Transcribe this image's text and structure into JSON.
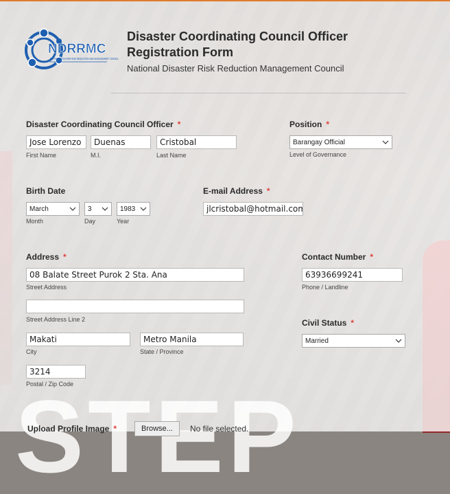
{
  "header": {
    "logo_text": "NDRRMC",
    "logo_subtext": "NATIONAL DISASTER RISK REDUCTION AND MANAGEMENT COUNCIL",
    "title": "Disaster Coordinating Council Officer Registration Form",
    "subtitle": "National Disaster Risk Reduction Management Council"
  },
  "officer": {
    "label": "Disaster Coordinating Council Officer",
    "first_name": "Jose Lorenzo",
    "first_name_sub": "First Name",
    "mi": "Duenas",
    "mi_sub": "M.I.",
    "last_name": "Cristobal",
    "last_name_sub": "Last Name"
  },
  "position": {
    "label": "Position",
    "value": "Barangay Official",
    "sub": "Level of Governance"
  },
  "birth": {
    "label": "Birth Date",
    "month": "March",
    "month_sub": "Month",
    "day": "3",
    "day_sub": "Day",
    "year": "1983",
    "year_sub": "Year"
  },
  "email": {
    "label": "E-mail Address",
    "value": "jlcristobal@hotmail.com"
  },
  "address": {
    "label": "Address",
    "street": "08 Balate Street Purok 2 Sta. Ana",
    "street_sub": "Street Address",
    "line2": "",
    "line2_sub": "Street Address Line 2",
    "city": "Makati",
    "city_sub": "City",
    "state": "Metro Manila",
    "state_sub": "State / Province",
    "postal": "3214",
    "postal_sub": "Postal / Zip Code"
  },
  "contact": {
    "label": "Contact Number",
    "value": "63936699241",
    "sub": "Phone / Landline"
  },
  "civil": {
    "label": "Civil Status",
    "value": "Married"
  },
  "upload": {
    "label": "Upload Profile Image",
    "button": "Browse...",
    "status": "No file selected."
  },
  "watermark": "STEP",
  "required_mark": "*",
  "colors": {
    "accent": "#e07b2a",
    "required": "#e0403a",
    "logo_blue": "#1f5fb0"
  }
}
